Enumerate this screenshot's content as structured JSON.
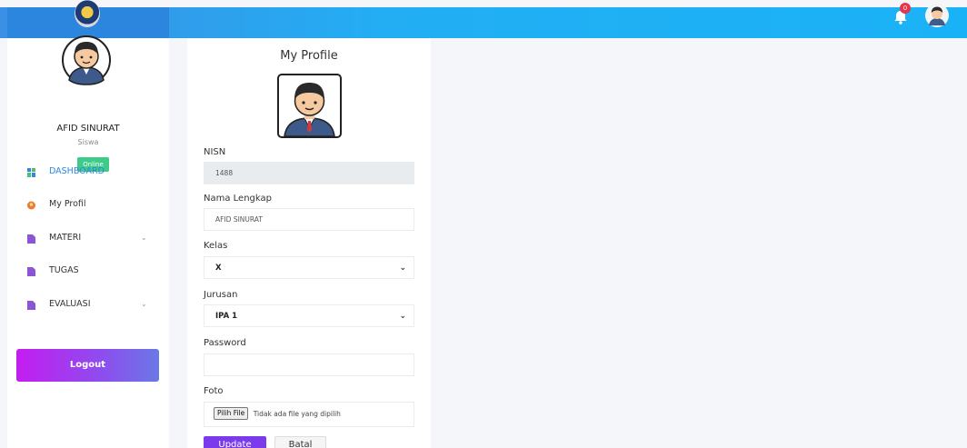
{
  "header": {
    "notification_count": "0",
    "icons": [
      "school-logo-icon",
      "bell-icon",
      "user-avatar-icon"
    ]
  },
  "sidebar": {
    "user_name": "AFID SINURAT",
    "user_role": "Siswa",
    "status": "Online",
    "items": [
      {
        "label": "DASHBOARD",
        "icon": "dashboard-icon",
        "active": true,
        "has_submenu": false
      },
      {
        "label": "My Profil",
        "icon": "profile-icon",
        "active": false,
        "has_submenu": false
      },
      {
        "label": "MATERI",
        "icon": "document-icon",
        "active": false,
        "has_submenu": true
      },
      {
        "label": "TUGAS",
        "icon": "document-icon",
        "active": false,
        "has_submenu": false
      },
      {
        "label": "EVALUASI",
        "icon": "document-icon",
        "active": false,
        "has_submenu": true
      }
    ],
    "logout_label": "Logout"
  },
  "profile": {
    "title": "My Profile",
    "nisn_label": "NISN",
    "nisn_value": "1488",
    "nama_label": "Nama Lengkap",
    "nama_value": "AFID SINURAT",
    "kelas_label": "Kelas",
    "kelas_value": "X",
    "jurusan_label": "Jurusan",
    "jurusan_value": "IPA 1",
    "password_label": "Password",
    "password_value": "",
    "foto_label": "Foto",
    "file_button": "Pilih File",
    "file_status": "Tidak ada file yang dipilih",
    "update_label": "Update",
    "batal_label": "Batal"
  },
  "colors": {
    "topbar": "#23aef3",
    "active_menu": "#2d86de",
    "online_badge": "#3ecb8a",
    "logout_gradient_start": "#c41df0",
    "logout_gradient_end": "#6a78e6",
    "update_button": "#7c3aed"
  }
}
